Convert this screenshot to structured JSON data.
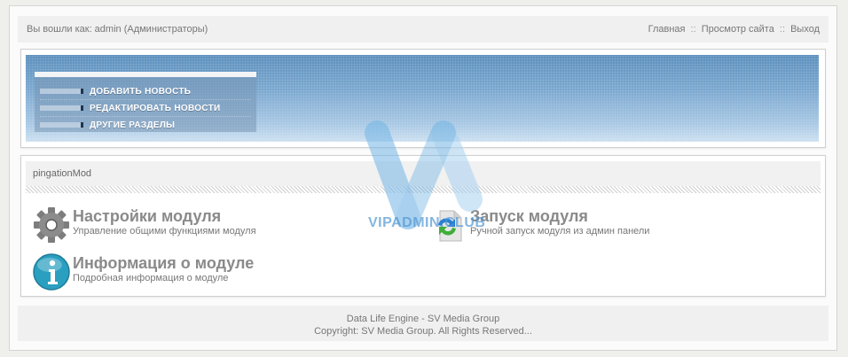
{
  "topbar": {
    "login_text": "Вы вошли как: admin (Администраторы)",
    "links": [
      "Главная",
      "Просмотр сайта",
      "Выход"
    ],
    "separator": "::"
  },
  "banner_menu": {
    "items": [
      "ДОБАВИТЬ НОВОСТЬ",
      "РЕДАКТИРОВАТЬ НОВОСТИ",
      "ДРУГИЕ РАЗДЕЛЫ"
    ]
  },
  "panel": {
    "title": "pingationMod",
    "modules": [
      {
        "title": "Настройки модуля",
        "desc": "Управление общими функциями модуля",
        "icon": "gear-icon"
      },
      {
        "title": "Запуск модуля",
        "desc": "Ручной запуск модуля из админ панели",
        "icon": "refresh-icon"
      },
      {
        "title": "Информация о модуле",
        "desc": "Подробная информация о модуле",
        "icon": "info-icon"
      }
    ]
  },
  "footer": {
    "line1": "Data Life Engine - SV Media Group",
    "line2": "Copyright: SV Media Group. All Rights Reserved..."
  },
  "watermark": {
    "text": "VIPADMIN.CLUB"
  },
  "colors": {
    "banner_blue": "#6e9dc8",
    "accent_teal": "#2a9fc0"
  }
}
